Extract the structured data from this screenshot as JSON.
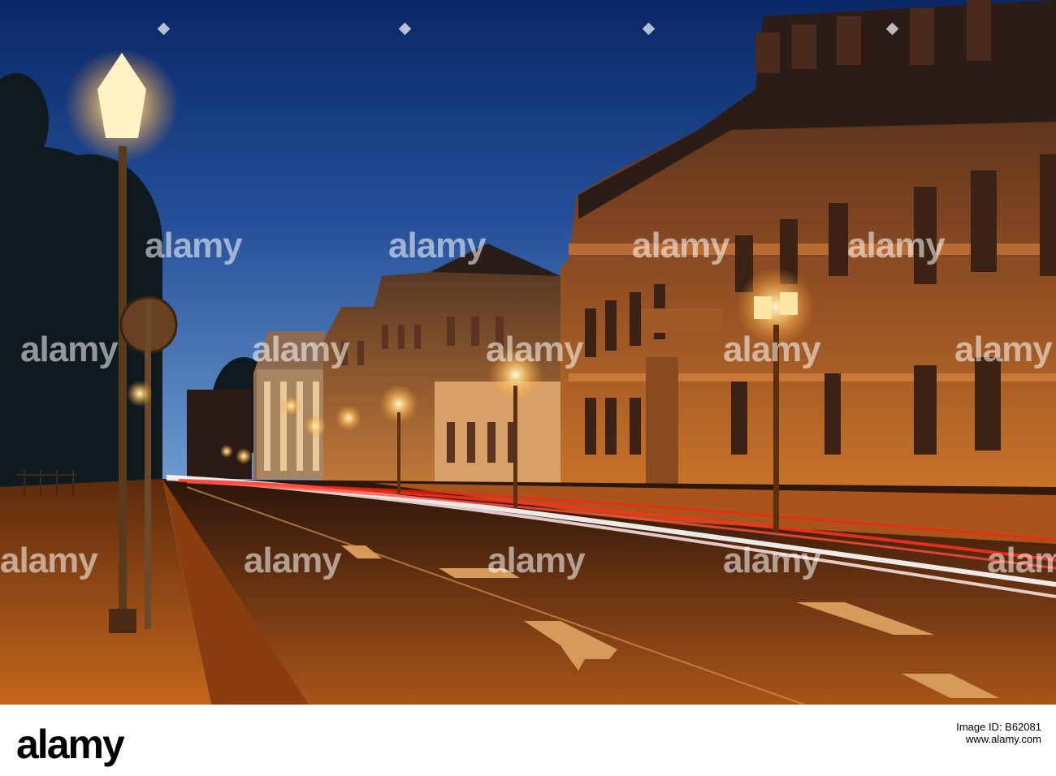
{
  "watermark": {
    "text": "alamy"
  },
  "footer": {
    "logo": "alamy",
    "image_id_label": "Image ID: B62081",
    "stock_label": "www.alamy.com",
    "image_id": "B62081"
  },
  "colors": {
    "sky_top": "#0d2a6b",
    "sky_bottom": "#3a6cb0",
    "lamp_glow": "#ffd27a",
    "street": "#5a2e10",
    "sidewalk": "#b35a18"
  }
}
